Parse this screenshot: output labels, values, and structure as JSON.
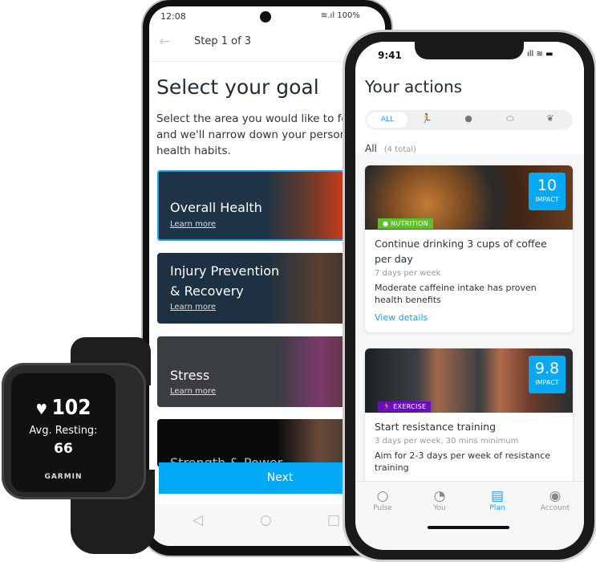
{
  "android": {
    "status": {
      "time": "12:08",
      "battery": "100%"
    },
    "header": {
      "back_icon": "arrow-left-icon",
      "title": "Step 1 of 3"
    },
    "heading": "Select your goal",
    "description": [
      "Select the area you would like to foc",
      "and we'll narrow down your persona",
      "health habits."
    ],
    "goals": [
      {
        "title": "Overall Health",
        "link": "Learn more",
        "selected": true
      },
      {
        "title_line1": "Injury Prevention",
        "title_line2": "& Recovery",
        "link": "Learn more"
      },
      {
        "title": "Stress",
        "link": "Learn more"
      },
      {
        "title": "Strength & Power"
      }
    ],
    "next_label": "Next",
    "accent": "#03a9f4"
  },
  "iphone": {
    "status": {
      "time": "9:41"
    },
    "title": "Your actions",
    "filters": [
      {
        "label": "ALL",
        "active": true
      },
      {
        "icon": "running-icon"
      },
      {
        "icon": "apple-icon"
      },
      {
        "icon": "pill-icon"
      },
      {
        "icon": "lotus-icon"
      }
    ],
    "section": {
      "label": "All",
      "count": "(4 total)"
    },
    "actions": [
      {
        "impact": "10",
        "impact_label": "IMPACT",
        "category": "NUTRITION",
        "category_color": "#5cc12a",
        "title": "Continue drinking 3 cups of coffee per day",
        "frequency": "7 days per week",
        "description": "Moderate caffeine intake has proven health benefits",
        "link": "View details"
      },
      {
        "impact": "9.8",
        "impact_label": "IMPACT",
        "category": "EXERCISE",
        "category_color": "#6a0dbd",
        "title": "Start resistance training",
        "frequency": "3 days per week, 30 mins minimum",
        "description": "Aim for 2-3 days per week of resistance training"
      }
    ],
    "tabs": [
      {
        "label": "Pulse",
        "icon": "circle-icon"
      },
      {
        "label": "You",
        "icon": "gauge-icon"
      },
      {
        "label": "Plan",
        "icon": "clipboard-icon",
        "active": true
      },
      {
        "label": "Account",
        "icon": "user-circle-icon"
      }
    ]
  },
  "watch": {
    "heart_rate": "102",
    "label": "Avg. Resting:",
    "resting": "66",
    "brand": "GARMIN"
  }
}
